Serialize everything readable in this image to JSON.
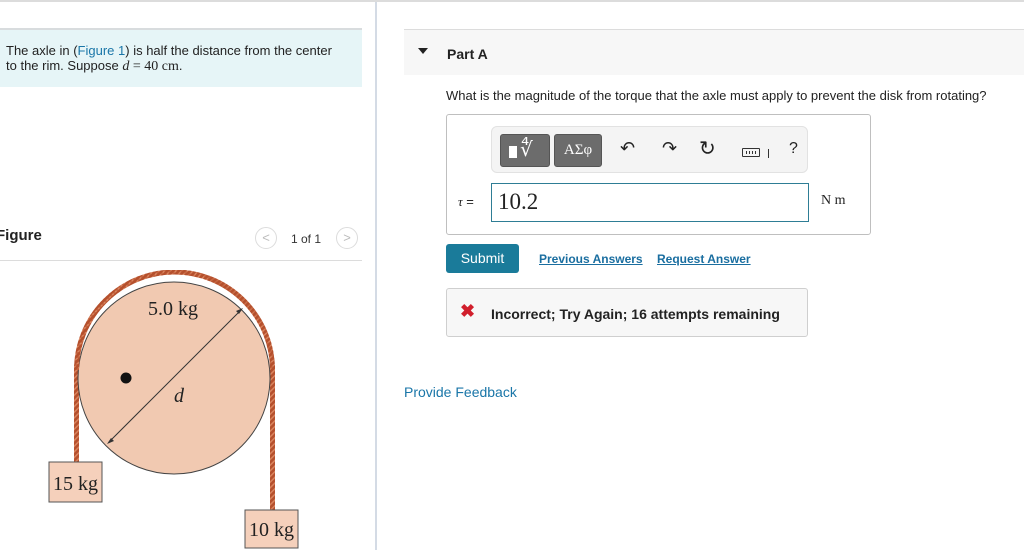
{
  "problem": {
    "text_before_link": "The axle in (",
    "link_text": "Figure 1",
    "text_after_link": ") is half the distance from the center",
    "line2_prefix": "to the rim. Suppose ",
    "var": "d",
    "equals": " = 40 ",
    "unit": "cm",
    "period": "."
  },
  "figure": {
    "title": "Figure",
    "pager": {
      "prev_icon": "chevron-left-icon",
      "prev_glyph": "<",
      "count": "1 of 1",
      "next_icon": "chevron-right-icon",
      "next_glyph": ">"
    },
    "labels": {
      "disk_mass": "5.0 kg",
      "diameter": "d",
      "left_block": "15 kg",
      "right_block": "10 kg"
    },
    "colors": {
      "disk_fill": "#f1c9b1",
      "rope": "#b5502d",
      "block_fill": "#f5d0bb"
    }
  },
  "part": {
    "title": "Part A",
    "caret_icon": "caret-down-icon",
    "question": "What is the magnitude of the torque that the axle must apply to prevent the disk from rotating?"
  },
  "answer": {
    "toolbar": {
      "template_icon": "templates-icon",
      "template_glyph": "∜",
      "greek_label": "ΑΣφ",
      "undo_glyph": "↶",
      "redo_glyph": "↷",
      "reset_glyph": "↻",
      "keyboard_icon": "keyboard-icon",
      "help_label": "?"
    },
    "variable": "τ",
    "equals": " =",
    "value": "10.2",
    "unit": "N m"
  },
  "actions": {
    "submit": "Submit",
    "previous_answers": "Previous Answers",
    "request_answer": "Request Answer"
  },
  "feedback": {
    "icon_glyph": "✖",
    "message": "Incorrect; Try Again; 16 attempts remaining"
  },
  "provide_feedback": "Provide Feedback"
}
